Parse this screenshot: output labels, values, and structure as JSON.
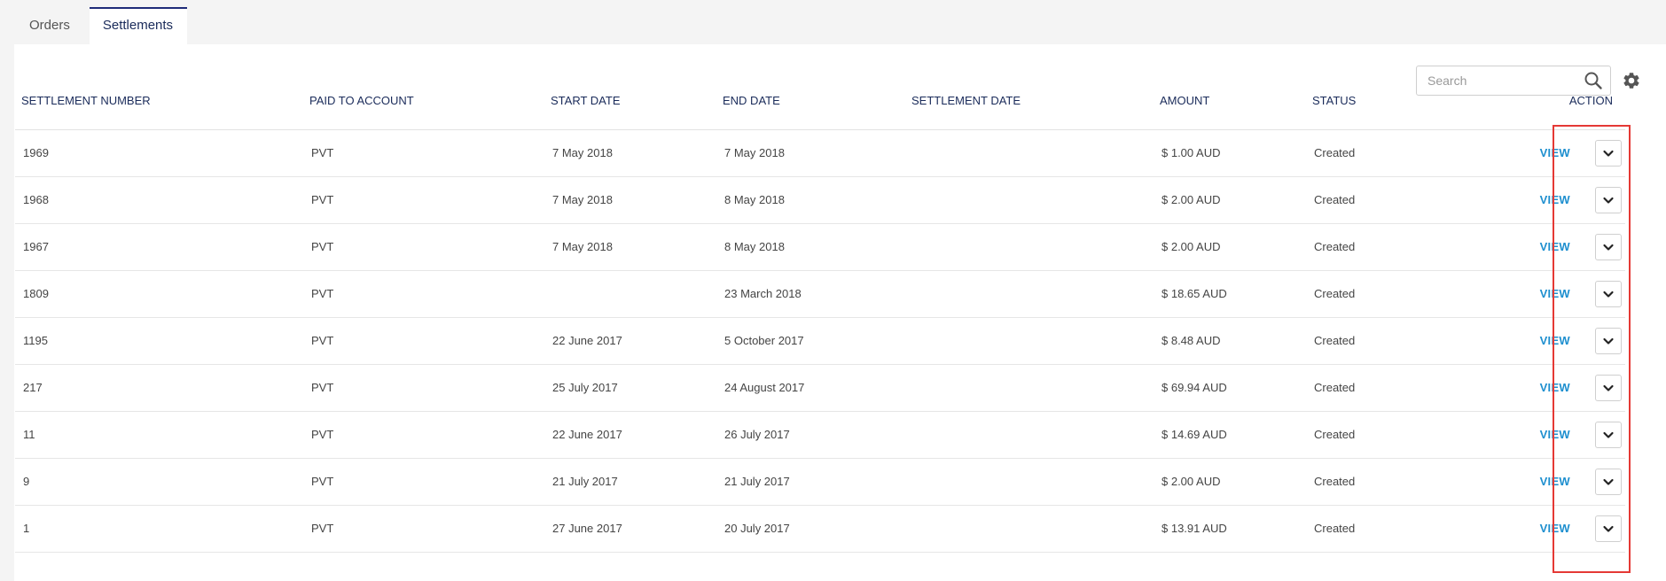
{
  "tabs": [
    {
      "label": "Orders",
      "active": false
    },
    {
      "label": "Settlements",
      "active": true
    }
  ],
  "search": {
    "placeholder": "Search",
    "value": ""
  },
  "icons": {
    "search": "search-icon",
    "settings": "gear-icon",
    "row_menu": "chevron-down-icon"
  },
  "colors": {
    "accent": "#1e8fcf",
    "header_text": "#1a2b5a",
    "highlight": "#e53935"
  },
  "table": {
    "columns": [
      "SETTLEMENT NUMBER",
      "PAID TO ACCOUNT",
      "START DATE",
      "END DATE",
      "SETTLEMENT DATE",
      "AMOUNT",
      "STATUS",
      "ACTION"
    ],
    "view_label": "VIEW",
    "rows": [
      {
        "number": "1969",
        "account": "PVT",
        "start": "7 May 2018",
        "end": "7 May 2018",
        "settlement_date": "",
        "amount": "$ 1.00 AUD",
        "status": "Created"
      },
      {
        "number": "1968",
        "account": "PVT",
        "start": "7 May 2018",
        "end": "8 May 2018",
        "settlement_date": "",
        "amount": "$ 2.00 AUD",
        "status": "Created"
      },
      {
        "number": "1967",
        "account": "PVT",
        "start": "7 May 2018",
        "end": "8 May 2018",
        "settlement_date": "",
        "amount": "$ 2.00 AUD",
        "status": "Created"
      },
      {
        "number": "1809",
        "account": "PVT",
        "start": "",
        "end": "23 March 2018",
        "settlement_date": "",
        "amount": "$ 18.65 AUD",
        "status": "Created"
      },
      {
        "number": "1195",
        "account": "PVT",
        "start": "22 June 2017",
        "end": "5 October 2017",
        "settlement_date": "",
        "amount": "$ 8.48 AUD",
        "status": "Created"
      },
      {
        "number": "217",
        "account": "PVT",
        "start": "25 July 2017",
        "end": "24 August 2017",
        "settlement_date": "",
        "amount": "$ 69.94 AUD",
        "status": "Created"
      },
      {
        "number": "11",
        "account": "PVT",
        "start": "22 June 2017",
        "end": "26 July 2017",
        "settlement_date": "",
        "amount": "$ 14.69 AUD",
        "status": "Created"
      },
      {
        "number": "9",
        "account": "PVT",
        "start": "21 July 2017",
        "end": "21 July 2017",
        "settlement_date": "",
        "amount": "$ 2.00 AUD",
        "status": "Created"
      },
      {
        "number": "1",
        "account": "PVT",
        "start": "27 June 2017",
        "end": "20 July 2017",
        "settlement_date": "",
        "amount": "$ 13.91 AUD",
        "status": "Created"
      }
    ]
  }
}
